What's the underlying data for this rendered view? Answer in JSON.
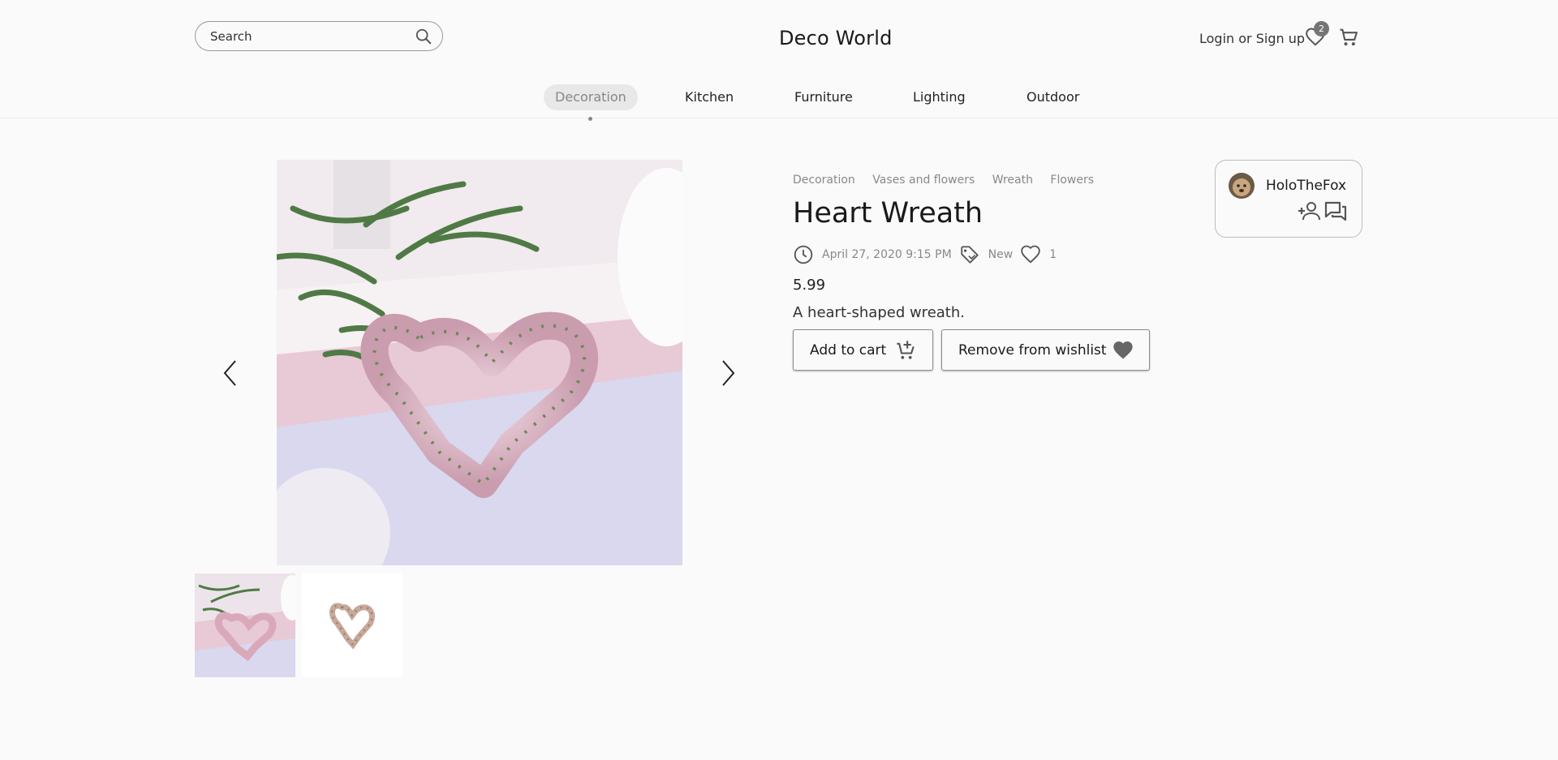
{
  "header": {
    "search_placeholder": "Search",
    "brand": "Deco World",
    "login_label": "Login",
    "or_label": "or",
    "signup_label": "Sign up",
    "wishlist_count": "2"
  },
  "nav": {
    "items": [
      {
        "label": "Decoration",
        "active": true
      },
      {
        "label": "Kitchen",
        "active": false
      },
      {
        "label": "Furniture",
        "active": false
      },
      {
        "label": "Lighting",
        "active": false
      },
      {
        "label": "Outdoor",
        "active": false
      }
    ]
  },
  "product": {
    "breadcrumbs": [
      "Decoration",
      "Vases and flowers",
      "Wreath",
      "Flowers"
    ],
    "title": "Heart Wreath",
    "date": "April 27, 2020 9:15 PM",
    "condition": "New",
    "likes": "1",
    "price": "5.99",
    "description": "A heart-shaped wreath.",
    "add_to_cart_label": "Add to cart",
    "remove_wishlist_label": "Remove from wishlist"
  },
  "seller": {
    "name": "HoloTheFox"
  },
  "icons": {
    "search": "search-icon",
    "wishlist": "heart-outline-icon",
    "cart": "cart-icon",
    "clock": "clock-icon",
    "tag": "tag-icon",
    "like": "heart-outline-icon",
    "add_cart": "cart-plus-icon",
    "remove_wishlist": "heart-filled-icon",
    "follow": "person-add-icon",
    "message": "chat-icon",
    "prev": "chevron-left-icon",
    "next": "chevron-right-icon"
  },
  "colors": {
    "background": "#fafafa",
    "active_nav_bg": "#e8e8e8",
    "muted_text": "#888888",
    "badge": "#757575",
    "icon": "#555555"
  }
}
